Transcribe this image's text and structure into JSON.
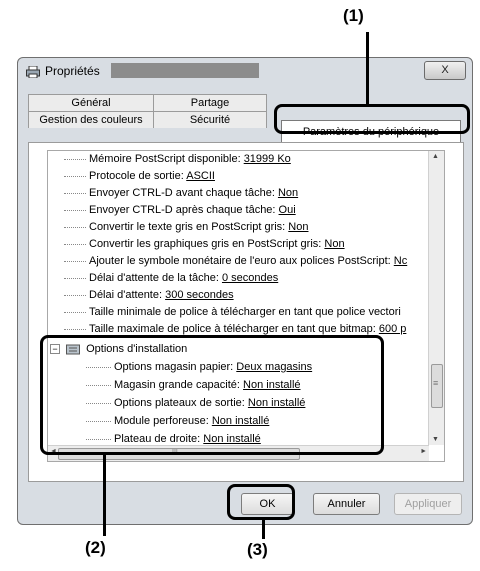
{
  "callouts": {
    "c1": "(1)",
    "c2": "(2)",
    "c3": "(3)"
  },
  "window": {
    "title": "Propriétés",
    "close": "X"
  },
  "tabs": {
    "general": "Général",
    "partage": "Partage",
    "gestion": "Gestion des couleurs",
    "securite": "Sécurité",
    "parametres": "Paramètres du périphérique"
  },
  "tree": [
    {
      "label": "Mémoire PostScript disponible: ",
      "value": "31999 Ko"
    },
    {
      "label": "Protocole de sortie: ",
      "value": "ASCII"
    },
    {
      "label": "Envoyer CTRL-D avant chaque tâche: ",
      "value": "Non"
    },
    {
      "label": "Envoyer CTRL-D après chaque tâche: ",
      "value": "Oui"
    },
    {
      "label": "Convertir le texte gris en PostScript gris: ",
      "value": "Non"
    },
    {
      "label": "Convertir les graphiques gris en PostScript gris: ",
      "value": "Non"
    },
    {
      "label": "Ajouter le symbole monétaire de l'euro aux polices PostScript: ",
      "value": "Nc"
    },
    {
      "label": "Délai d'attente de la tâche: ",
      "value": "0 secondes"
    },
    {
      "label": "Délai d'attente: ",
      "value": "300 secondes"
    },
    {
      "label": "Taille minimale de police à télécharger en tant que police vectori",
      "value": ""
    },
    {
      "label": "Taille maximale de police à télécharger en tant que bitmap: ",
      "value": "600 p"
    }
  ],
  "options": {
    "header": "Options d'installation",
    "items": [
      {
        "label": "Options magasin papier: ",
        "value": "Deux magasins"
      },
      {
        "label": "Magasin grande capacité: ",
        "value": "Non installé"
      },
      {
        "label": "Options plateaux de sortie: ",
        "value": "Non installé"
      },
      {
        "label": "Module perforeuse: ",
        "value": "Non installé"
      },
      {
        "label": "Plateau de droite: ",
        "value": "Non installé"
      }
    ]
  },
  "scroll": {
    "up": "▲",
    "down": "▼",
    "left": "◄",
    "right": "►",
    "grip": "≡",
    "hgrip": "III"
  },
  "buttons": {
    "ok": "OK",
    "annuler": "Annuler",
    "appliquer": "Appliquer"
  }
}
